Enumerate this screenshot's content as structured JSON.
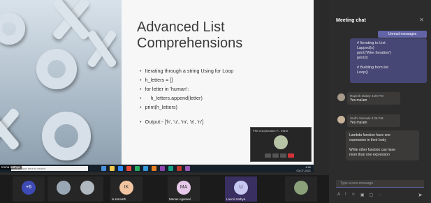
{
  "slide": {
    "title": "Advanced List Comprehensions",
    "bullets": [
      "Iterating through a string Using for Loop",
      "h_letters = []",
      "for letter in 'human':",
      "    h_letters.append(letter)",
      "print(h_letters)",
      "Output:- ['h', 'u', 'm', 'a', 'n']"
    ]
  },
  "mini_video": {
    "title": "PSE Ime/pheastrn P...  Infinit"
  },
  "taskbar": {
    "search_placeholder": "Type here to search",
    "clock_time": "4:56",
    "clock_date": "03-07-2021",
    "icon_colors": [
      "#4a90d9",
      "#f2c94c",
      "#2d8cff",
      "#e74c3c",
      "#27ae60",
      "#3498db",
      "#e67e22",
      "#8e44ad",
      "#16a085",
      "#c0392b",
      "#9b59b6"
    ]
  },
  "presenter": {
    "name": "Imma Sathya"
  },
  "participants": [
    {
      "initials": "+6",
      "name": "",
      "color": "#3e4bb5"
    },
    {
      "initials": "",
      "name": "",
      "color": "#9aa7b5"
    },
    {
      "initials": "",
      "name": "",
      "color": "#b0b8c0"
    },
    {
      "initials": "IK",
      "name": "ia Kamath",
      "color": "#f2c4a0"
    },
    {
      "initials": "MA",
      "name": "Manas Agarwal",
      "color": "#e6c8e9"
    },
    {
      "initials": "U",
      "name": "Laxmi Sathya",
      "color": "#c6c8f2"
    },
    {
      "initials": "",
      "name": "",
      "color": "#8aa17a"
    }
  ],
  "chat": {
    "title": "Meeting chat",
    "unread_label": "Unread messages",
    "my_message": "# Iterating to List\nLapped(s)\nprint('Wire Iteration')\nprint(i)\n\n# Building from list\nLoop()",
    "messages": [
      {
        "author": "Rupesh Dubey",
        "time": "3:29 PM",
        "text": "Yes ma'am"
      },
      {
        "author": "Sruthi Sannala",
        "time": "3:29 PM",
        "text": "Yes ma'am"
      }
    ],
    "reply_text": "Lambda function have one\nexpression in their body\n\nWhile other function can have\nmore than one expression",
    "compose_placeholder": "Type a new message"
  }
}
